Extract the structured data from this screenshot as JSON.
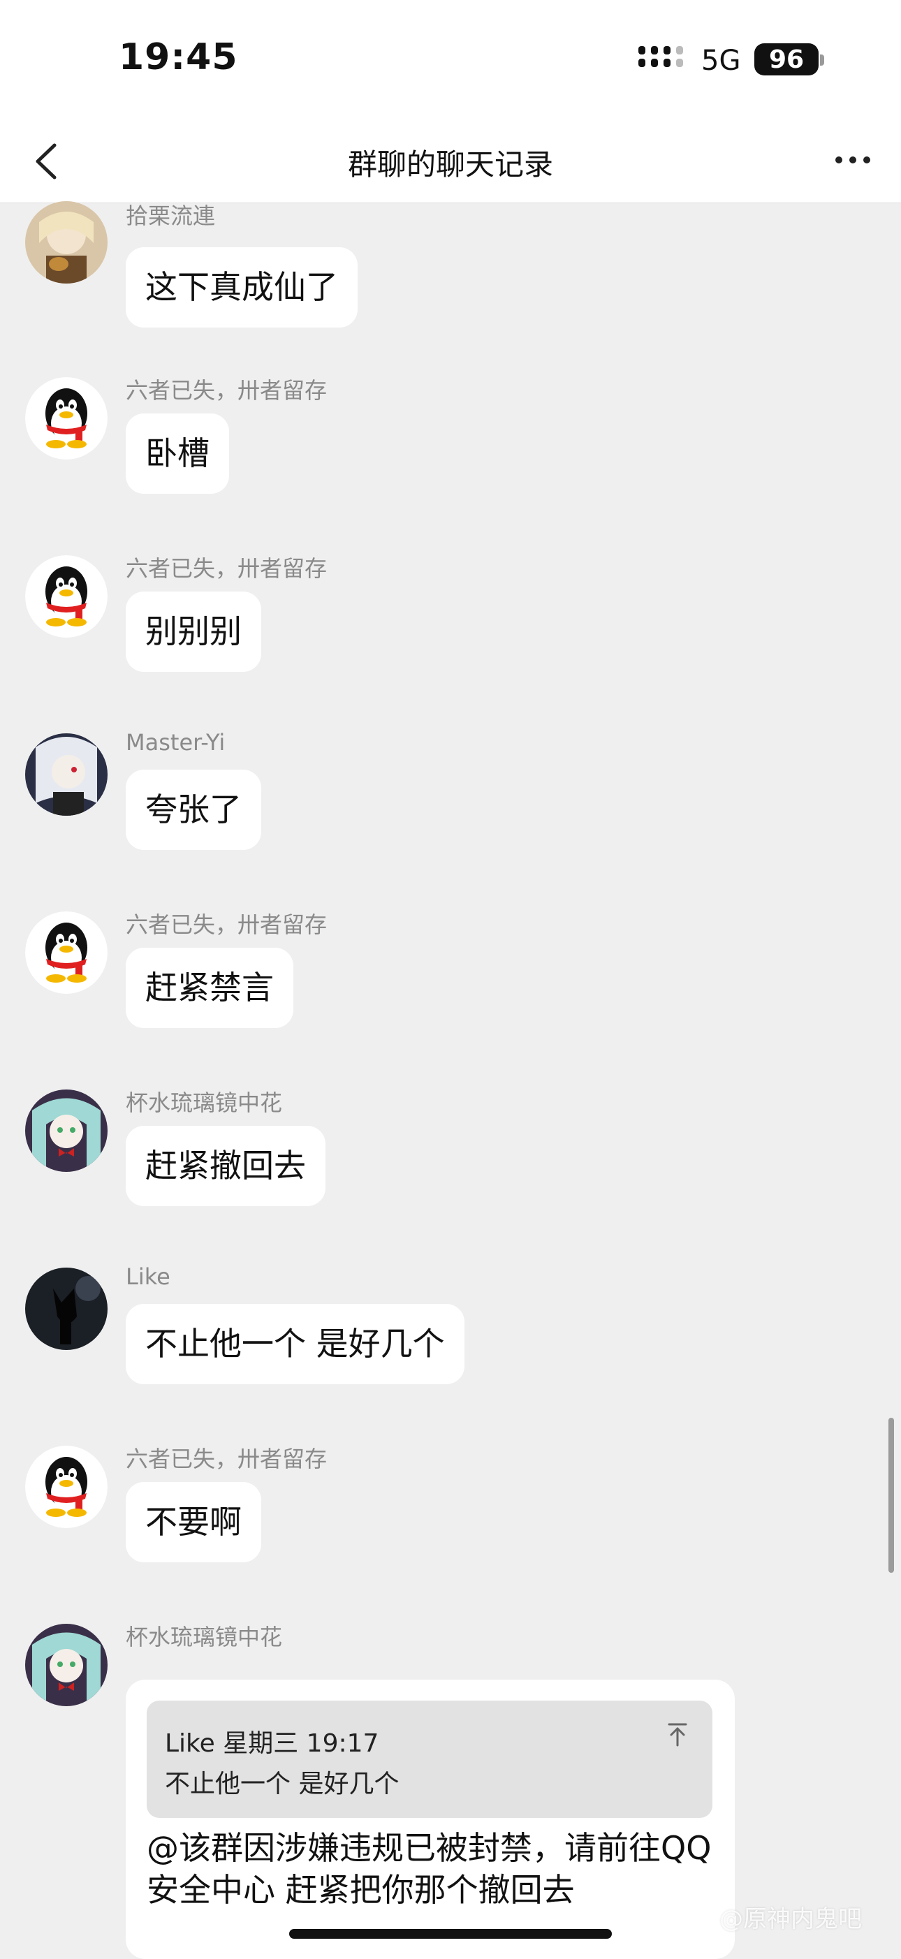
{
  "status_bar": {
    "time": "19:45",
    "network": "5G",
    "battery": "96"
  },
  "nav": {
    "title": "群聊的聊天记录"
  },
  "messages": [
    {
      "sender": "拾栗流連",
      "text": "这下真成仙了",
      "avatar": "anime-girl-avatar"
    },
    {
      "sender": "六者已失，卅者留存",
      "text": "卧槽",
      "avatar": "penguin-avatar"
    },
    {
      "sender": "六者已失，卅者留存",
      "text": "别别别",
      "avatar": "penguin-avatar"
    },
    {
      "sender": "Master-Yi",
      "text": "夸张了",
      "avatar": "anime-girl-avatar"
    },
    {
      "sender": "六者已失，卅者留存",
      "text": "赶紧禁言",
      "avatar": "penguin-avatar"
    },
    {
      "sender": "杯水琉璃镜中花",
      "text": "赶紧撤回去",
      "avatar": "anime-girl-avatar"
    },
    {
      "sender": "Like",
      "text": "不止他一个 是好几个",
      "avatar": "dark-silhouette-avatar"
    },
    {
      "sender": "六者已失，卅者留存",
      "text": "不要啊",
      "avatar": "penguin-avatar"
    }
  ],
  "quoted_message": {
    "sender": "杯水琉璃镜中花",
    "quote_header": "Like 星期三 19:17",
    "quote_text": "不止他一个 是好几个",
    "text": "@该群因涉嫌违规已被封禁，请前往QQ安全中心 赶紧把你那个撤回去"
  },
  "watermark": "@原神内鬼吧"
}
